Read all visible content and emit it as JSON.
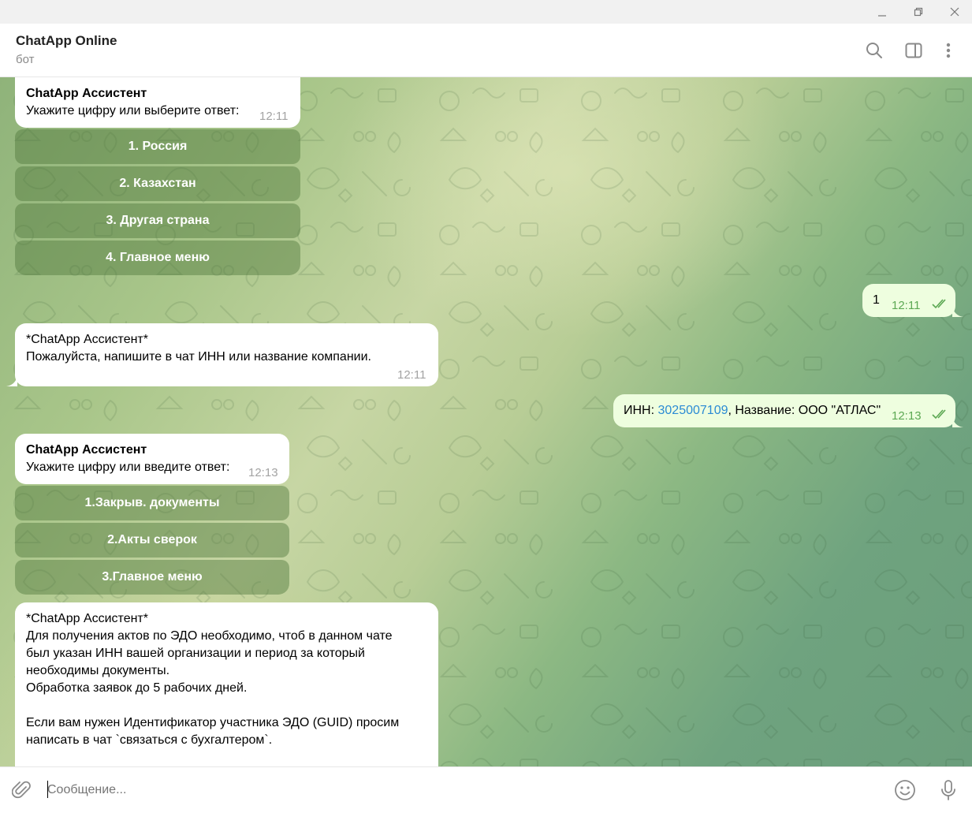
{
  "window": {
    "minimize_icon": "minimize-icon",
    "restore_icon": "restore-icon",
    "close_icon": "close-icon"
  },
  "header": {
    "title": "ChatApp Online",
    "subtitle": "бот",
    "icons": [
      "search-icon",
      "sidebar-toggle-icon",
      "more-vertical-icon"
    ]
  },
  "messages": {
    "m1": {
      "sender": "ChatApp Ассистент",
      "text": "Укажите цифру или выберите ответ:",
      "time": "12:11",
      "buttons": [
        "1. Россия",
        "2. Казахстан",
        "3. Другая страна",
        "4. Главное меню"
      ]
    },
    "m2": {
      "text": "1",
      "time": "12:11",
      "status": "read"
    },
    "m3": {
      "line1": "*ChatApp Ассистент*",
      "line2": "Пожалуйста, напишите в чат ИНН или название компании.",
      "time": "12:11"
    },
    "m4": {
      "prefix": "ИНН: ",
      "inn": "3025007109",
      "suffix": ", Название: ООО \"АТЛАС\"",
      "time": "12:13",
      "status": "read"
    },
    "m5": {
      "sender": "ChatApp Ассистент",
      "text": "Укажите цифру или введите ответ:",
      "time": "12:13",
      "buttons": [
        "1.Закрыв. документы",
        "2.Акты сверок",
        "3.Главное меню"
      ]
    },
    "m6": {
      "lines": [
        "*ChatApp Ассистент*",
        "Для получения актов по ЭДО необходимо, чтоб в данном чате",
        "был указан ИНН вашей организации и период за который",
        "необходимы документы.",
        "Обработка заявок до 5 рабочих дней.",
        "",
        "Если вам нужен Идентификатор участника ЭДО (GUID) просим",
        "написать в чат `связаться с бухгалтером`."
      ]
    }
  },
  "input": {
    "placeholder": "Сообщение...",
    "value": "",
    "icons": [
      "attach-icon",
      "emoji-icon",
      "microphone-icon"
    ]
  },
  "colors": {
    "accent": "#5ca853",
    "link": "#2b8bd4",
    "outgoing_bubble": "#eefedf"
  }
}
